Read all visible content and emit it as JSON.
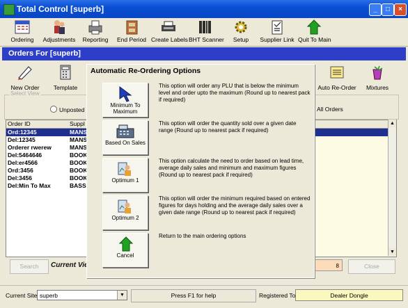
{
  "window": {
    "title": "Total Control [superb]"
  },
  "toolbar": {
    "items": [
      {
        "label": "Ordering",
        "icon": "calendar-icon"
      },
      {
        "label": "Adjustments",
        "icon": "people-icon"
      },
      {
        "label": "Reporting",
        "icon": "printer-icon"
      },
      {
        "label": "End Period",
        "icon": "file-cabinet-icon"
      },
      {
        "label": "Create Labels",
        "icon": "label-printer-icon"
      },
      {
        "label": "BHT Scanner",
        "icon": "barcode-icon"
      },
      {
        "label": "Setup",
        "icon": "gear-icon"
      },
      {
        "label": "Supplier Link",
        "icon": "clipboard-icon"
      },
      {
        "label": "Quit To Main",
        "icon": "green-arrow-icon"
      }
    ]
  },
  "orders": {
    "header": "Orders For [superb]",
    "new_order": "New Order",
    "template": "Template",
    "auto_reorder": "Auto Re-Order",
    "mixtures": "Mixtures",
    "select_view": "Select View",
    "radio_unposted": "Unposted O",
    "radio_all": "All Orders",
    "columns": [
      "Order ID",
      "Suppl"
    ],
    "rows": [
      {
        "id": "Ord:12345",
        "supplier": "MANS"
      },
      {
        "id": "Del:12345",
        "supplier": "MANS"
      },
      {
        "id": "Orderer rwerew",
        "supplier": "MANS"
      },
      {
        "id": "Del:5464646",
        "supplier": "BOOK"
      },
      {
        "id": "Del:er4566",
        "supplier": "BOOK"
      },
      {
        "id": "Ord:3456",
        "supplier": "BOOK"
      },
      {
        "id": "Del:3456",
        "supplier": "BOOK"
      },
      {
        "id": "Del:Min To Max",
        "supplier": "BASS"
      }
    ],
    "search": "Search",
    "current_view": "Current Vie",
    "close": "Close",
    "indicator": "8"
  },
  "dialog": {
    "title": "Automatic Re-Ordering Options",
    "options": [
      {
        "label": "Minimum To Maximum",
        "icon": "arrow-cursor-icon",
        "desc": "This option will order any PLU that is below the minimum level and order upto the maximum (Round up to nearest pack if required)"
      },
      {
        "label": "Based On Sales",
        "icon": "cash-register-icon",
        "desc": "This option will order the quantity sold over a given date range (Round up to nearest pack if required)"
      },
      {
        "label": "Optimum 1",
        "icon": "person-chart-icon",
        "desc": "This option calculate the need to order based on lead time, average daily sales and minimum and maximum figures (Round up to nearest pack if required)"
      },
      {
        "label": "Optimum 2",
        "icon": "person-chart-icon",
        "desc": "This option will order the minimum required based on entered figures for days holding and the average daily sales over a given date range (Round up to nearest pack if required)"
      },
      {
        "label": "Cancel",
        "icon": "green-arrow-icon",
        "desc": "Return to the main ordering options"
      }
    ]
  },
  "status": {
    "current_site_label": "Current Site:",
    "current_site": "superb",
    "help": "Press F1 for help",
    "registered_label": "Registered To:",
    "registered": "Dealer Dongle"
  }
}
